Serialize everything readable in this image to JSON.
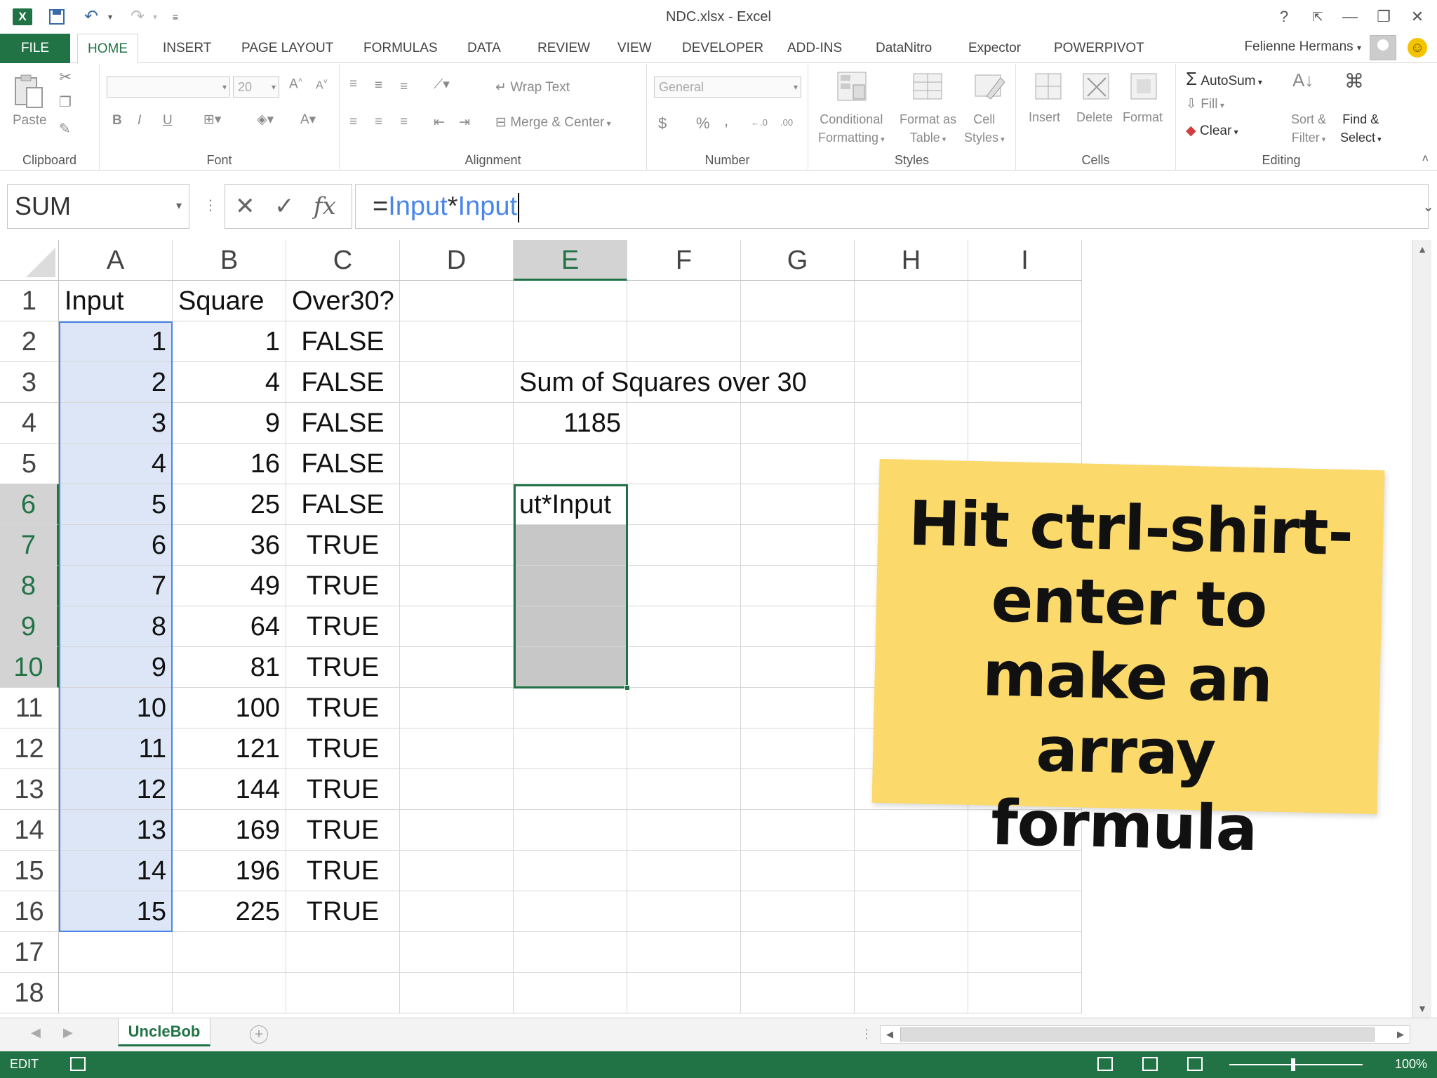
{
  "window": {
    "title": "NDC.xlsx - Excel",
    "user": "Felienne Hermans",
    "help": "?",
    "minimize": "—",
    "restore": "❐",
    "close": "✕"
  },
  "ribbon_tabs": [
    "FILE",
    "HOME",
    "INSERT",
    "PAGE LAYOUT",
    "FORMULAS",
    "DATA",
    "REVIEW",
    "VIEW",
    "DEVELOPER",
    "ADD-INS",
    "DataNitro",
    "Expector",
    "POWERPIVOT"
  ],
  "ribbon": {
    "clipboard": {
      "label": "Clipboard",
      "paste": "Paste"
    },
    "font": {
      "label": "Font",
      "size": "20",
      "bold": "B",
      "italic": "I",
      "underline": "U"
    },
    "alignment": {
      "label": "Alignment",
      "wrap": "Wrap Text",
      "merge": "Merge & Center"
    },
    "number": {
      "label": "Number",
      "format": "General",
      "currency": "$",
      "percent": "%",
      "comma": ",",
      "inc": "←.0 .00",
      "dec": ".00 →.0"
    },
    "styles": {
      "label": "Styles",
      "conditional1": "Conditional",
      "conditional2": "Formatting",
      "format_as1": "Format as",
      "format_as2": "Table",
      "cell_styles1": "Cell",
      "cell_styles2": "Styles"
    },
    "cells": {
      "label": "Cells",
      "insert": "Insert",
      "delete": "Delete",
      "format": "Format"
    },
    "editing": {
      "label": "Editing",
      "autosum": "AutoSum",
      "fill": "Fill",
      "clear": "Clear",
      "sort1": "Sort &",
      "sort2": "Filter",
      "find1": "Find &",
      "find2": "Select"
    }
  },
  "formula_bar": {
    "name_box": "SUM",
    "formula_eq": "=",
    "formula_ref1": "Input",
    "formula_op": "*",
    "formula_ref2": "Input"
  },
  "columns": [
    "A",
    "B",
    "C",
    "D",
    "E",
    "F",
    "G",
    "H",
    "I"
  ],
  "rows": [
    "1",
    "2",
    "3",
    "4",
    "5",
    "6",
    "7",
    "8",
    "9",
    "10",
    "11",
    "12",
    "13",
    "14",
    "15",
    "16",
    "17",
    "18"
  ],
  "table": {
    "headers": [
      "Input",
      "Square",
      "Over30?"
    ],
    "input": [
      "1",
      "2",
      "3",
      "4",
      "5",
      "6",
      "7",
      "8",
      "9",
      "10",
      "11",
      "12",
      "13",
      "14",
      "15"
    ],
    "square": [
      "1",
      "4",
      "9",
      "16",
      "25",
      "36",
      "49",
      "64",
      "81",
      "100",
      "121",
      "144",
      "169",
      "196",
      "225"
    ],
    "over30": [
      "FALSE",
      "FALSE",
      "FALSE",
      "FALSE",
      "FALSE",
      "TRUE",
      "TRUE",
      "TRUE",
      "TRUE",
      "TRUE",
      "TRUE",
      "TRUE",
      "TRUE",
      "TRUE",
      "TRUE"
    ]
  },
  "summary": {
    "label": "Sum of Squares over 30",
    "value": "1185",
    "editing_cell": "ut*Input"
  },
  "note": {
    "text": "Hit ctrl-shirt- enter to make an array formula"
  },
  "sheet": {
    "tab": "UncleBob"
  },
  "status": {
    "mode": "EDIT",
    "zoom": "100%"
  },
  "colors": {
    "excel_green": "#217346",
    "range_highlight": "#dde6f7",
    "range_border": "#4a86e8",
    "note_yellow": "#fbd96a"
  }
}
